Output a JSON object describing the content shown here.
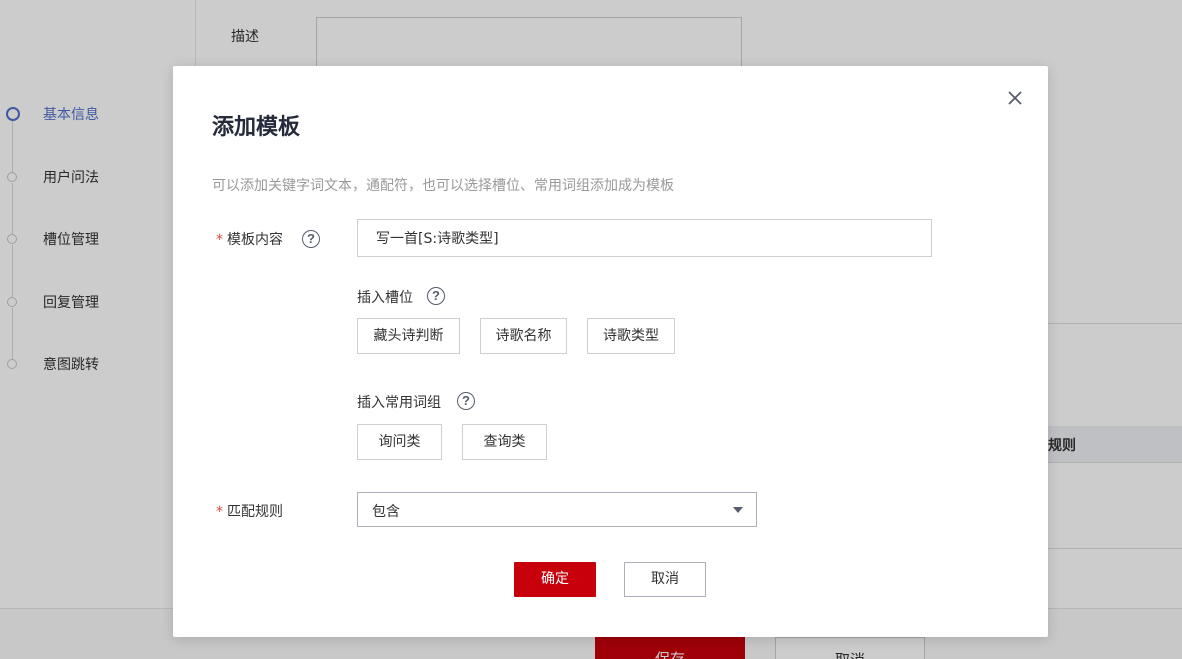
{
  "background": {
    "steps": [
      {
        "label": "基本信息",
        "active": true
      },
      {
        "label": "用户问法",
        "active": false
      },
      {
        "label": "槽位管理",
        "active": false
      },
      {
        "label": "回复管理",
        "active": false
      },
      {
        "label": "意图跳转",
        "active": false
      }
    ],
    "desc_label": "描述",
    "table_header_partial": "规则",
    "footer": {
      "save_label": "保存",
      "cancel_label": "取消"
    }
  },
  "dialog": {
    "title": "添加模板",
    "hint": "可以添加关键字词文本，通配符，也可以选择槽位、常用词组添加成为模板",
    "template_content": {
      "required_mark": "*",
      "label": "模板内容",
      "value": "写一首[S:诗歌类型]"
    },
    "insert_slot": {
      "label": "插入槽位",
      "chips": [
        "藏头诗判断",
        "诗歌名称",
        "诗歌类型"
      ]
    },
    "insert_phrase": {
      "label": "插入常用词组",
      "chips": [
        "询问类",
        "查询类"
      ]
    },
    "match_rule": {
      "required_mark": "*",
      "label": "匹配规则",
      "selected": "包含"
    },
    "ok_label": "确定",
    "cancel_label": "取消"
  },
  "colors": {
    "primary": "#c7000b",
    "active_step": "#526ecc",
    "required": "#e54545"
  }
}
